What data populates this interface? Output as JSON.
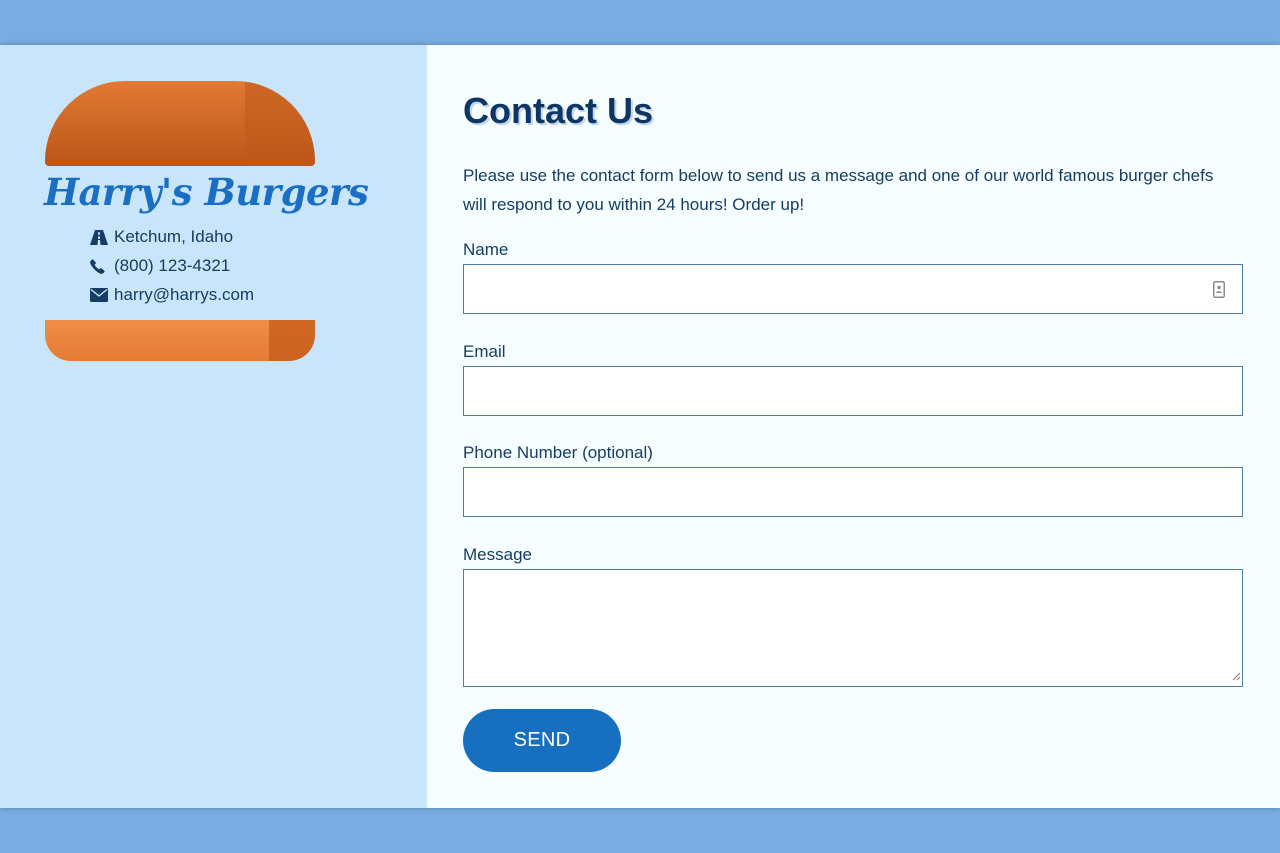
{
  "brand": {
    "name": "Harry's Burgers",
    "location": "Ketchum, Idaho",
    "phone": "(800) 123-4321",
    "email": "harry@harrys.com",
    "icons": [
      "road-icon",
      "phone-icon",
      "envelope-icon"
    ]
  },
  "contact": {
    "title": "Contact Us",
    "intro": "Please use the contact form below to send us a message and one of our world famous burger chefs will respond to you within 24 hours! Order up!",
    "fields": {
      "name_label": "Name",
      "email_label": "Email",
      "phone_label": "Phone Number (optional)",
      "message_label": "Message"
    },
    "send_label": "SEND"
  },
  "colors": {
    "background": "#79ade2",
    "sidebar": "#c8e5fb",
    "main": "#f5fdfe",
    "accent": "#166fbf",
    "bun": "#e27a34",
    "text": "#163d63"
  }
}
